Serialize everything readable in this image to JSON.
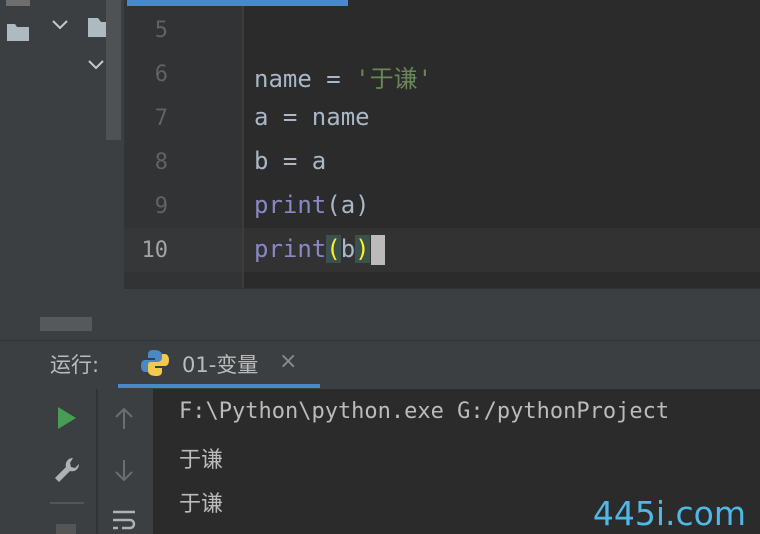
{
  "editor": {
    "lines": [
      {
        "num": "5",
        "code": ""
      },
      {
        "num": "6",
        "name": "name",
        "op": " = ",
        "str": "'于谦'"
      },
      {
        "num": "7",
        "code": "a = name"
      },
      {
        "num": "8",
        "code": "b = a"
      },
      {
        "num": "9",
        "fn": "print",
        "arg": "(a)"
      },
      {
        "num": "10",
        "fn": "print",
        "paren_open": "(",
        "arg": "b",
        "paren_close": ")"
      }
    ]
  },
  "run_panel": {
    "label": "运行:",
    "tab_label": "01-变量",
    "close": "×"
  },
  "console": {
    "lines": [
      "F:\\Python\\python.exe G:/pythonProject",
      "于谦",
      "于谦"
    ]
  },
  "watermark": "445i.com",
  "colors": {
    "accent_blue": "#4a88c7",
    "run_green": "#499c54",
    "string_green": "#6a8759",
    "builtin_purple": "#8888c6"
  },
  "icons": {
    "run": "play-icon",
    "wrench": "wrench-icon",
    "up": "arrow-up-icon",
    "down": "arrow-down-icon",
    "folder": "folder-icon"
  }
}
